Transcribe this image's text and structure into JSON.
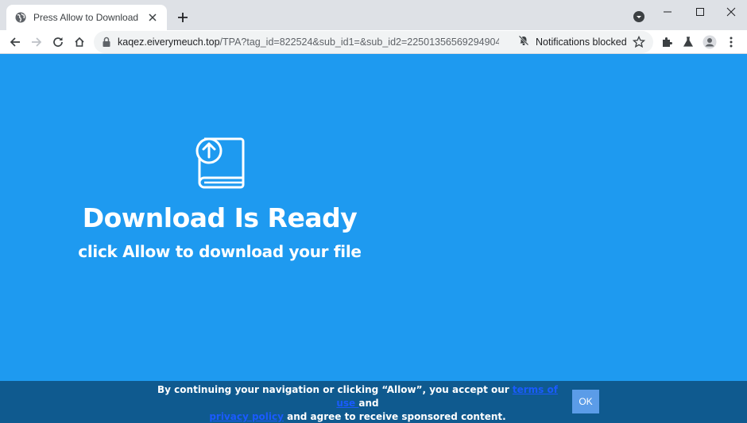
{
  "browser": {
    "tab": {
      "title": "Press Allow to Download"
    },
    "address": {
      "host": "kaqez.eiverymeuch.top",
      "path": "/TPA?tag_id=822524&sub_id1=&sub_id2=2250135656929490439&c..."
    },
    "notifications_label": "Notifications blocked"
  },
  "page": {
    "title": "Download Is Ready",
    "subtitle": "click Allow to download your file"
  },
  "consent": {
    "text_before": "By continuing your navigation or clicking “Allow”, you accept our ",
    "terms_link": "terms of use ",
    "text_and": "and",
    "privacy_link": "privacy policy",
    "text_after": " and agree to receive sponsored content.",
    "ok_label": "OK"
  },
  "colors": {
    "page_background": "#1e9af0",
    "consent_background": "#0f5a8f",
    "ok_button": "#5b9ce8",
    "link": "#1a5bff"
  },
  "icons": [
    "globe-icon",
    "close-icon",
    "plus-icon",
    "tab-search-icon",
    "minimize-icon",
    "maximize-icon",
    "window-close-icon",
    "back-icon",
    "forward-icon",
    "reload-icon",
    "home-icon",
    "lock-icon",
    "bell-off-icon",
    "star-icon",
    "extensions-icon",
    "labs-icon",
    "profile-icon",
    "menu-icon",
    "download-book-icon"
  ]
}
